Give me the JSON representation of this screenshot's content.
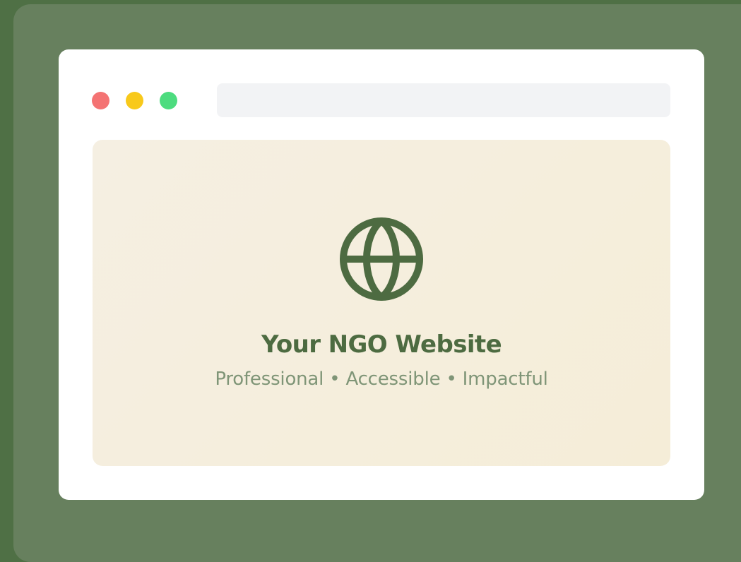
{
  "window": {
    "controls": [
      {
        "name": "close",
        "color": "#f47373"
      },
      {
        "name": "minimize",
        "color": "#f8c91b"
      },
      {
        "name": "maximize",
        "color": "#4ddc7f"
      }
    ],
    "address_bar": {
      "value": ""
    }
  },
  "hero": {
    "icon": "globe-icon",
    "title": "Your NGO Website",
    "tagline": "Professional • Accessible • Impactful"
  },
  "colors": {
    "background": "#4f7045",
    "outer_card": "#67805e",
    "window": "#ffffff",
    "address_bar": "#f2f3f5",
    "panel_start": "#f5efe2",
    "panel_end": "#f5edd8",
    "accent": "#4d6b41",
    "muted_text": "#7f9577"
  }
}
